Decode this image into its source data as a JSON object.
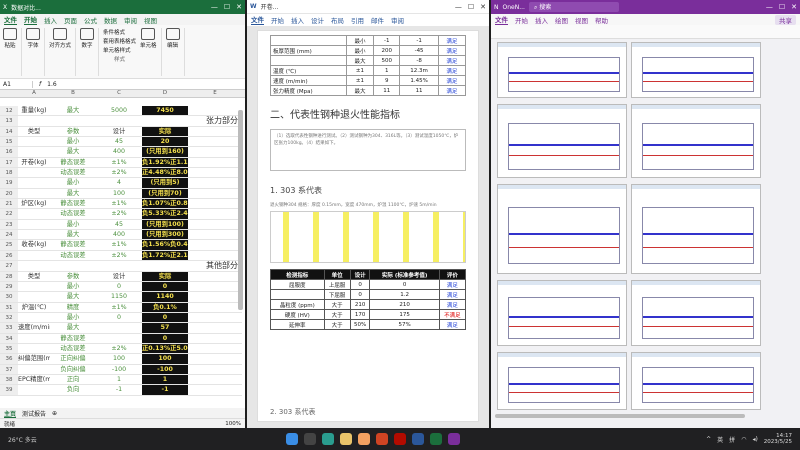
{
  "excel": {
    "title": "数据对比...",
    "tabs": [
      "文件",
      "开始",
      "插入",
      "页面",
      "公式",
      "数据",
      "审阅",
      "视图"
    ],
    "ribbon": [
      "粘贴",
      "字体",
      "对齐方式",
      "数字",
      "条件格式",
      "套用表格格式",
      "单元格样式",
      "单元格",
      "编辑"
    ],
    "ribbon_group": "样式",
    "cell_ref": "A1",
    "formula": "f",
    "formula_value": "1.6",
    "cols": [
      "",
      "A",
      "B",
      "C",
      "D",
      "E"
    ],
    "rows": [
      {
        "n": "12",
        "a": "重量(kg)",
        "b": "最大",
        "c": "5000",
        "d": "7450",
        "t": "cut"
      },
      {
        "n": "13",
        "sec": "张力部分"
      },
      {
        "n": "14",
        "a": "类型",
        "b": "参数",
        "c": "设计",
        "d": "实际",
        "t": "head"
      },
      {
        "n": "15",
        "b": "最小",
        "c": "45",
        "d": "20"
      },
      {
        "n": "16",
        "b": "最大",
        "c": "400",
        "d": "(只用到160)"
      },
      {
        "n": "17",
        "a": "开卷(kg)",
        "b": "静态误差",
        "c": "±1%",
        "d": "负1.92%正1.13%"
      },
      {
        "n": "18",
        "b": "动态误差",
        "c": "±2%",
        "d": "正4.48%正8.06%"
      },
      {
        "n": "19",
        "b": "最小",
        "c": "4",
        "d": "(只用到5)"
      },
      {
        "n": "20",
        "b": "最大",
        "c": "100",
        "d": "(只用到70)"
      },
      {
        "n": "21",
        "a": "炉区(kg)",
        "b": "静态误差",
        "c": "±1%",
        "d": "负1.07%正0.85%"
      },
      {
        "n": "22",
        "b": "动态误差",
        "c": "±2%",
        "d": "负5.33%正2.44%"
      },
      {
        "n": "23",
        "b": "最小",
        "c": "45",
        "d": "(只用到100)"
      },
      {
        "n": "24",
        "b": "最大",
        "c": "400",
        "d": "(只用到300)"
      },
      {
        "n": "25",
        "a": "收卷(kg)",
        "b": "静态误差",
        "c": "±1%",
        "d": "负1.56%负0.47%"
      },
      {
        "n": "26",
        "b": "动态误差",
        "c": "±2%",
        "d": "负1.72%正2.14%"
      },
      {
        "n": "27",
        "sec": "其他部分"
      },
      {
        "n": "28",
        "a": "类型",
        "b": "参数",
        "c": "设计",
        "d": "实际",
        "t": "head"
      },
      {
        "n": "29",
        "b": "最小",
        "c": "0",
        "d": "0"
      },
      {
        "n": "30",
        "b": "最大",
        "c": "1150",
        "d": "1140"
      },
      {
        "n": "31",
        "a": "炉温(℃)",
        "b": "精度",
        "c": "±1%",
        "d": "负0.1%"
      },
      {
        "n": "32",
        "b": "最小",
        "c": "0",
        "d": "0"
      },
      {
        "n": "33",
        "a": "速度(m/min)",
        "b": "最大",
        "c": "",
        "d": "57"
      },
      {
        "n": "34",
        "b": "静态误差",
        "c": "",
        "d": "0"
      },
      {
        "n": "35",
        "b": "动态误差",
        "c": "±2%",
        "d": "正0.13%正5.01%"
      },
      {
        "n": "36",
        "a": "纠偏范围(mm)",
        "b": "正向纠偏",
        "c": "100",
        "d": "100"
      },
      {
        "n": "37",
        "b": "负向纠偏",
        "c": "-100",
        "d": "-100"
      },
      {
        "n": "38",
        "a": "EPC精度(mm)",
        "b": "正向",
        "c": "1",
        "d": "1"
      },
      {
        "n": "39",
        "b": "负向",
        "c": "-1",
        "d": "-1"
      }
    ],
    "sheets": [
      "主页",
      "测试报告"
    ],
    "status": "就绪",
    "zoom": "100%"
  },
  "word": {
    "title": "开卷...",
    "tabs": [
      "文件",
      "开始",
      "插入",
      "设计",
      "布局",
      "引用",
      "邮件",
      "审阅"
    ],
    "t1": [
      [
        "",
        "最小",
        "-1",
        "-1",
        "满足"
      ],
      [
        "板厚范围 (mm)",
        "最小",
        "200",
        "-45",
        "满足"
      ],
      [
        "",
        "最大",
        "500",
        "-8",
        "满足"
      ],
      [
        "温度 (℃)",
        "±1",
        "1",
        "12.3m",
        "满足"
      ],
      [
        "速度 (m/min)",
        "±1",
        "9",
        "1.45%",
        "满足"
      ],
      [
        "张力精度 (Mpa)",
        "最大",
        "11",
        "11",
        "满足"
      ]
    ],
    "h2": "二、代表性钢种退火性能指标",
    "note": "（1）选取代表性钢种进行测试。（2）测试钢种为304、316L等。（3）测试温度1050℃，炉区张力100kg。（4）结果如下。",
    "h3": "1. 303 系代表",
    "smalltxt": "退火钢种304 规格：厚度 0.15mm，宽度 470mm，炉温 1100℃，炉速 5m/min",
    "t2h": [
      "检测指标",
      "单位",
      "设计",
      "实际 (标准参考值)",
      "评价"
    ],
    "t2": [
      [
        "屈服度",
        "上屈服",
        "0",
        "0",
        "满足"
      ],
      [
        "",
        "下屈服",
        "0",
        "1.2",
        "满足"
      ],
      [
        "晶粒度 (ppm)",
        "大于",
        "210",
        "210",
        "满足"
      ],
      [
        "硬度 (HV)",
        "大于",
        "170",
        "175",
        "不满足"
      ],
      [
        "延伸率",
        "大于",
        "50%",
        "57%",
        "满足"
      ]
    ],
    "bottom": "2. 303 系代表"
  },
  "onenote": {
    "title": "OneN...",
    "search": "搜索",
    "tabs": [
      "文件",
      "开始",
      "插入",
      "绘图",
      "视图",
      "帮助"
    ],
    "share": "共享"
  },
  "taskbar": {
    "weather": "26°C 多云",
    "lang": "英",
    "ime": "拼",
    "time": "14:17",
    "date": "2023/5/25"
  }
}
